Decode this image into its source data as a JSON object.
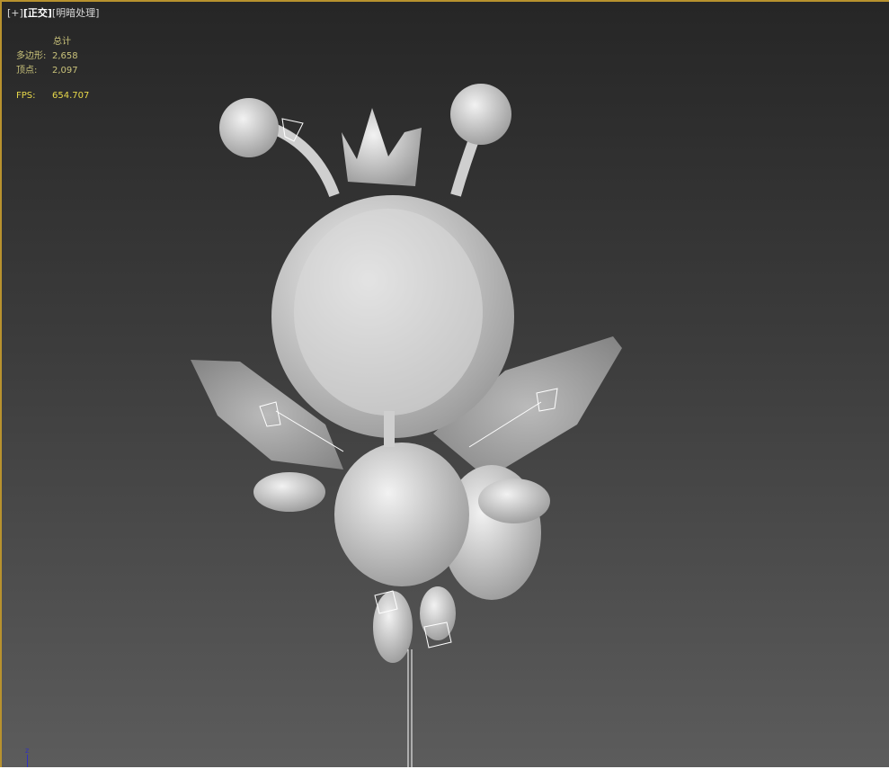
{
  "viewport": {
    "labels": {
      "plus": "[+]",
      "view": "[正交]",
      "shading": "[明暗处理]"
    },
    "stats": {
      "header": "总计",
      "polygons_label": "多边形:",
      "polygons": "2,658",
      "vertices_label": "顶点:",
      "vertices": "2,097",
      "fps_label": "FPS:",
      "fps": "654.707"
    },
    "axis": {
      "z": "z"
    },
    "colors": {
      "border": "#b8922e",
      "stats": "#c9c27a",
      "fps": "#e8d94a"
    }
  }
}
